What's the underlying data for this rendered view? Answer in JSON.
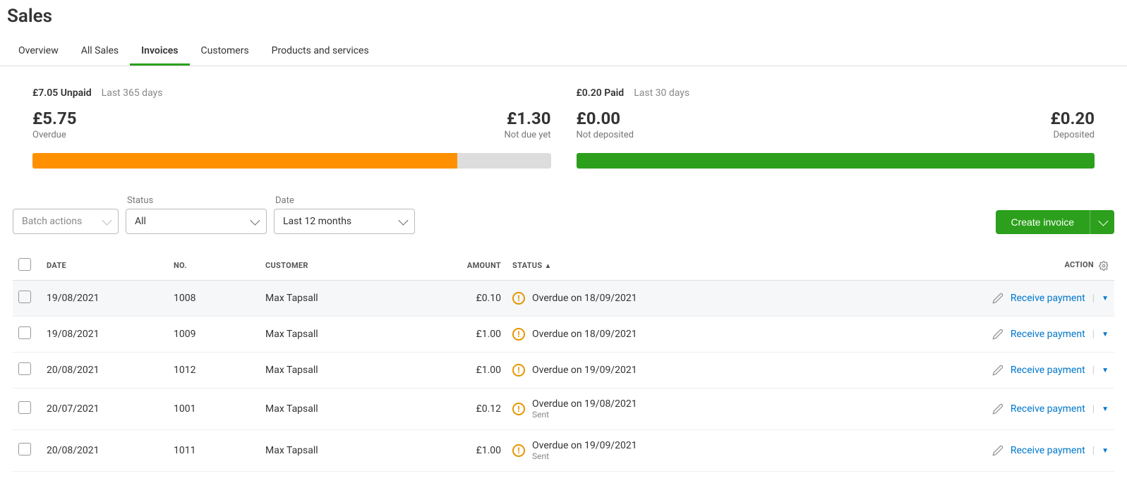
{
  "page_title": "Sales",
  "tabs": [
    {
      "label": "Overview",
      "active": false
    },
    {
      "label": "All Sales",
      "active": false
    },
    {
      "label": "Invoices",
      "active": true
    },
    {
      "label": "Customers",
      "active": false
    },
    {
      "label": "Products and services",
      "active": false
    }
  ],
  "summary": {
    "unpaid": {
      "total": "£7.05 Unpaid",
      "period": "Last 365 days",
      "left_value": "£5.75",
      "left_label": "Overdue",
      "right_value": "£1.30",
      "right_label": "Not due yet",
      "fill_pct": 82
    },
    "paid": {
      "total": "£0.20 Paid",
      "period": "Last 30 days",
      "left_value": "£0.00",
      "left_label": "Not deposited",
      "right_value": "£0.20",
      "right_label": "Deposited",
      "fill_pct": 100
    }
  },
  "filters": {
    "batch_actions": "Batch actions",
    "status_label": "Status",
    "status_value": "All",
    "date_label": "Date",
    "date_value": "Last 12 months"
  },
  "create_button": "Create invoice",
  "columns": {
    "date": "DATE",
    "no": "NO.",
    "customer": "CUSTOMER",
    "amount": "AMOUNT",
    "status": "STATUS",
    "action": "ACTION"
  },
  "rows": [
    {
      "date": "19/08/2021",
      "no": "1008",
      "customer": "Max Tapsall",
      "amount": "£0.10",
      "status": "Overdue on 18/09/2021",
      "sub": "",
      "action": "Receive payment",
      "highlight": true
    },
    {
      "date": "19/08/2021",
      "no": "1009",
      "customer": "Max Tapsall",
      "amount": "£1.00",
      "status": "Overdue on 18/09/2021",
      "sub": "",
      "action": "Receive payment",
      "highlight": false
    },
    {
      "date": "20/08/2021",
      "no": "1012",
      "customer": "Max Tapsall",
      "amount": "£1.00",
      "status": "Overdue on 19/09/2021",
      "sub": "",
      "action": "Receive payment",
      "highlight": false
    },
    {
      "date": "20/07/2021",
      "no": "1001",
      "customer": "Max Tapsall",
      "amount": "£0.12",
      "status": "Overdue on 19/08/2021",
      "sub": "Sent",
      "action": "Receive payment",
      "highlight": false
    },
    {
      "date": "20/08/2021",
      "no": "1011",
      "customer": "Max Tapsall",
      "amount": "£1.00",
      "status": "Overdue on 19/09/2021",
      "sub": "Sent",
      "action": "Receive payment",
      "highlight": false
    }
  ]
}
